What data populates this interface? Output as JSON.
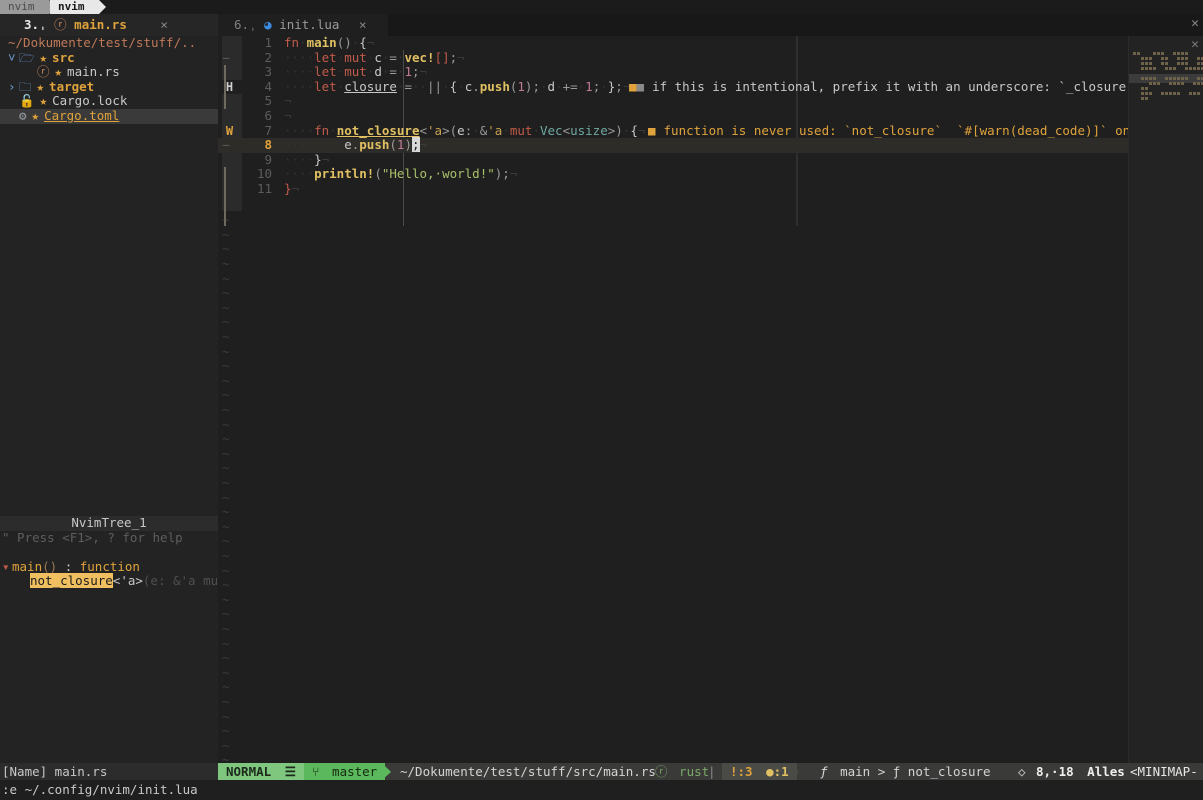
{
  "terminal": {
    "tab_inactive": "nvim",
    "tab_active": "nvim"
  },
  "tabline": {
    "tabs": [
      {
        "number": "3.",
        "sep": "ˌ",
        "icon": "rust-icon",
        "icon_glyph": "ⓡ",
        "label": "main.rs",
        "close": "×",
        "active": true
      },
      {
        "number": "6.",
        "sep": "ˌ",
        "icon": "lua-icon",
        "icon_glyph": "◕",
        "label": "init.lua",
        "close": "×",
        "active": false
      }
    ]
  },
  "sidebar": {
    "root_path": "~/Dokumente/test/stuff/..",
    "items": [
      {
        "indent": 0,
        "chevron": "˅",
        "icon": "folder-open-icon",
        "icon_glyph": "🗁",
        "star": "★",
        "label": "src",
        "kind": "dir",
        "selected": false
      },
      {
        "indent": 1,
        "chevron": "",
        "icon": "rust-file-icon",
        "icon_glyph": "ⓡ",
        "star": "★",
        "label": "main.rs",
        "kind": "file",
        "selected": false
      },
      {
        "indent": 0,
        "chevron": "›",
        "icon": "folder-icon",
        "icon_glyph": "🗀",
        "star": "★",
        "label": "target",
        "kind": "dir",
        "selected": false
      },
      {
        "indent": 0,
        "chevron": "",
        "icon": "lock-icon",
        "icon_glyph": "🔓",
        "star": "★",
        "label": "Cargo.lock",
        "kind": "file",
        "selected": false
      },
      {
        "indent": 0,
        "chevron": "",
        "icon": "gear-icon",
        "icon_glyph": "⚙",
        "star": "★",
        "label": "Cargo.toml",
        "kind": "file",
        "selected": true
      }
    ],
    "symbols_header": "NvimTree_1",
    "help_hint": "\" Press <F1>, ? for help",
    "symbols": [
      {
        "marker": "▾",
        "name": "main",
        "paren": "()",
        "sep": " : ",
        "kind": "function",
        "highlight": false
      },
      {
        "marker": "",
        "name": "not_closure",
        "generic": "<'a>",
        "signature": "(e: &'a mu",
        "highlight": true
      }
    ],
    "status": "[Name] main.rs"
  },
  "editor": {
    "lines": [
      {
        "n": "1",
        "sign": "",
        "fold": "",
        "tokens": [
          {
            "t": "fn",
            "c": "kw"
          },
          {
            "t": "·",
            "c": "ws"
          },
          {
            "t": "main",
            "c": "fn"
          },
          {
            "t": "()",
            "c": "punc"
          },
          {
            "t": "·",
            "c": "ws"
          },
          {
            "t": "{",
            "c": "brace"
          },
          {
            "t": "¬",
            "c": "eol"
          }
        ]
      },
      {
        "n": "2",
        "sign": "",
        "fold": "–",
        "tokens": [
          {
            "t": "····",
            "c": "ws"
          },
          {
            "t": "let",
            "c": "kw"
          },
          {
            "t": "·",
            "c": "ws"
          },
          {
            "t": "mut",
            "c": "kw"
          },
          {
            "t": "·",
            "c": "ws"
          },
          {
            "t": "c",
            "c": "id"
          },
          {
            "t": "·",
            "c": "ws"
          },
          {
            "t": "=",
            "c": "op"
          },
          {
            "t": "·",
            "c": "ws"
          },
          {
            "t": "vec!",
            "c": "mac"
          },
          {
            "t": "[]",
            "c": "kw"
          },
          {
            "t": ";",
            "c": "punc"
          },
          {
            "t": "¬",
            "c": "eol"
          }
        ]
      },
      {
        "n": "3",
        "sign": "",
        "fold": "",
        "tokens": [
          {
            "t": "····",
            "c": "ws"
          },
          {
            "t": "let",
            "c": "kw"
          },
          {
            "t": "·",
            "c": "ws"
          },
          {
            "t": "mut",
            "c": "kw"
          },
          {
            "t": "·",
            "c": "ws"
          },
          {
            "t": "d",
            "c": "id"
          },
          {
            "t": "·",
            "c": "ws"
          },
          {
            "t": "=",
            "c": "op"
          },
          {
            "t": "·",
            "c": "ws"
          },
          {
            "t": "1",
            "c": "num"
          },
          {
            "t": ";",
            "c": "punc"
          },
          {
            "t": "¬",
            "c": "eol"
          }
        ]
      },
      {
        "n": "4",
        "sign": "H",
        "fold": "",
        "tokens": [
          {
            "t": "····",
            "c": "ws"
          },
          {
            "t": "let",
            "c": "kw"
          },
          {
            "t": "·",
            "c": "ws"
          },
          {
            "t": "closure",
            "c": "idu"
          },
          {
            "t": "·",
            "c": "ws"
          },
          {
            "t": "=",
            "c": "op"
          },
          {
            "t": "··",
            "c": "ws"
          },
          {
            "t": "||",
            "c": "punc"
          },
          {
            "t": "·",
            "c": "ws"
          },
          {
            "t": "{",
            "c": "brace"
          },
          {
            "t": "·",
            "c": "ws"
          },
          {
            "t": "c",
            "c": "id"
          },
          {
            "t": ".",
            "c": "punc"
          },
          {
            "t": "push",
            "c": "fn"
          },
          {
            "t": "(",
            "c": "punc"
          },
          {
            "t": "1",
            "c": "num"
          },
          {
            "t": ")",
            "c": "punc"
          },
          {
            "t": ";",
            "c": "punc"
          },
          {
            "t": "·",
            "c": "ws"
          },
          {
            "t": "d",
            "c": "id"
          },
          {
            "t": "·",
            "c": "ws"
          },
          {
            "t": "+=",
            "c": "op"
          },
          {
            "t": "·",
            "c": "ws"
          },
          {
            "t": "1",
            "c": "num"
          },
          {
            "t": ";",
            "c": "punc"
          },
          {
            "t": "·",
            "c": "ws"
          },
          {
            "t": "}",
            "c": "brace"
          },
          {
            "t": ";",
            "c": "punc"
          },
          {
            "t": "¬",
            "c": "eol"
          }
        ]
      },
      {
        "n": "5",
        "sign": "",
        "fold": "",
        "tokens": [
          {
            "t": "¬",
            "c": "eol"
          }
        ]
      },
      {
        "n": "6",
        "sign": "",
        "fold": "",
        "tokens": [
          {
            "t": "¬",
            "c": "eol"
          }
        ]
      },
      {
        "n": "7",
        "sign": "W",
        "fold": "",
        "tokens": [
          {
            "t": "····",
            "c": "ws"
          },
          {
            "t": "fn",
            "c": "kw"
          },
          {
            "t": "·",
            "c": "ws"
          },
          {
            "t": "not_closure",
            "c": "fnu"
          },
          {
            "t": "<",
            "c": "punc"
          },
          {
            "t": "'a",
            "c": "life"
          },
          {
            "t": ">",
            "c": "punc"
          },
          {
            "t": "(",
            "c": "punc"
          },
          {
            "t": "e",
            "c": "id"
          },
          {
            "t": ":",
            "c": "punc"
          },
          {
            "t": "·",
            "c": "ws"
          },
          {
            "t": "&",
            "c": "op"
          },
          {
            "t": "'a",
            "c": "life"
          },
          {
            "t": "·",
            "c": "ws"
          },
          {
            "t": "mut",
            "c": "kw"
          },
          {
            "t": "·",
            "c": "ws"
          },
          {
            "t": "Vec",
            "c": "typ"
          },
          {
            "t": "<",
            "c": "punc"
          },
          {
            "t": "usize",
            "c": "typ"
          },
          {
            "t": ">",
            "c": "punc"
          },
          {
            "t": ")",
            "c": "punc"
          },
          {
            "t": "·",
            "c": "ws"
          },
          {
            "t": "{",
            "c": "brace"
          },
          {
            "t": "¬",
            "c": "eol"
          }
        ]
      },
      {
        "n": "8",
        "sign": "",
        "fold": "–",
        "cursorline": true,
        "tokens": [
          {
            "t": "········",
            "c": "ws"
          },
          {
            "t": "e",
            "c": "id"
          },
          {
            "t": ".",
            "c": "punc"
          },
          {
            "t": "push",
            "c": "fn"
          },
          {
            "t": "(",
            "c": "punc"
          },
          {
            "t": "1",
            "c": "num"
          },
          {
            "t": ")",
            "c": "punc"
          },
          {
            "t": ";",
            "c": "cursor"
          },
          {
            "t": "¬",
            "c": "eol"
          }
        ]
      },
      {
        "n": "9",
        "sign": "",
        "fold": "",
        "tokens": [
          {
            "t": "····",
            "c": "ws"
          },
          {
            "t": "}",
            "c": "brace"
          },
          {
            "t": "¬",
            "c": "eol"
          }
        ]
      },
      {
        "n": "10",
        "sign": "",
        "fold": "",
        "tokens": [
          {
            "t": "····",
            "c": "ws"
          },
          {
            "t": "println!",
            "c": "mac"
          },
          {
            "t": "(",
            "c": "punc"
          },
          {
            "t": "\"Hello,·world!\"",
            "c": "str"
          },
          {
            "t": ")",
            "c": "punc"
          },
          {
            "t": ";",
            "c": "punc"
          },
          {
            "t": "¬",
            "c": "eol"
          }
        ]
      },
      {
        "n": "11",
        "sign": "",
        "fold": "",
        "tokens": [
          {
            "t": "}",
            "c": "kw"
          },
          {
            "t": "¬",
            "c": "eol"
          }
        ]
      }
    ],
    "diagnostics": [
      {
        "line": 4,
        "squares": "■■",
        "text": "if this is intentional, prefix it with an underscore: `_closure`"
      },
      {
        "line": 7,
        "squares": "■",
        "text": "function is never used: `not_closure`  `#[warn(dead_code)]` on"
      }
    ],
    "filler_char": "~"
  },
  "statusline": {
    "mode": "NORMAL",
    "mode_icon": "☰",
    "branch_icon": "⑂",
    "branch": "master",
    "file_path": "~/Dokumente/test/stuff/src/main.rs",
    "filetype_icon": "ⓡ",
    "filetype": "rust",
    "warn_icon": "!",
    "warn_count": ":3",
    "hint_icon": "●",
    "hint_count": ":1",
    "breadcrumb_fn_icon": "ƒ",
    "breadcrumb": "main > ƒ not_closure",
    "pos_icon": "◇",
    "position": "8,·18",
    "percent": "Alles",
    "minimap_label": "<MINIMAP-"
  },
  "cmdline": {
    "text": ":e ~/.config/nvim/init.lua"
  },
  "colors": {
    "bg": "#1f1f1f",
    "sidebar_bg": "#232323",
    "accent_orange": "#e0a33c",
    "mode_green": "#7fc77f",
    "branch_green": "#5cb85c",
    "keyword_red": "#c05a4a",
    "string_green": "#a8c06a",
    "cursorline": "#2e2c28"
  }
}
